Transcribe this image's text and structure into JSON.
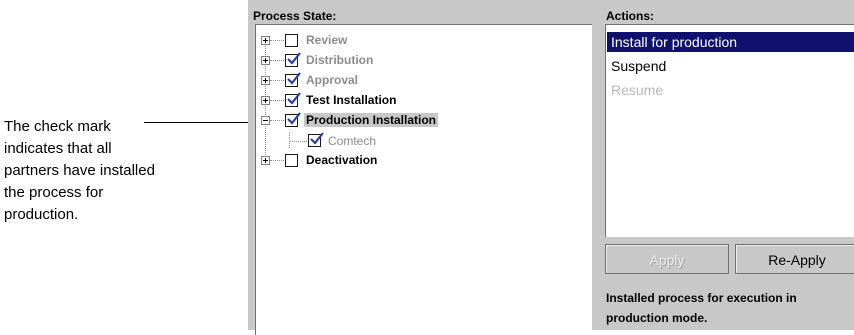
{
  "callout": {
    "lines": [
      "The check mark",
      "indicates that all",
      "partners have installed",
      "the process for",
      "production."
    ]
  },
  "process_state": {
    "heading": "Process State:",
    "items": [
      {
        "label": "Review",
        "checked": false,
        "style": "grey",
        "expander": "plus"
      },
      {
        "label": "Distribution",
        "checked": true,
        "style": "grey",
        "expander": "plus"
      },
      {
        "label": "Approval",
        "checked": true,
        "style": "grey",
        "expander": "plus"
      },
      {
        "label": "Test Installation",
        "checked": true,
        "style": "black",
        "expander": "plus"
      },
      {
        "label": "Production Installation",
        "checked": true,
        "style": "black",
        "expander": "minus",
        "selected": true
      },
      {
        "label": "Comtech",
        "checked": true,
        "style": "child",
        "expander": "none"
      },
      {
        "label": "Deactivation",
        "checked": false,
        "style": "black",
        "expander": "plus"
      }
    ]
  },
  "actions": {
    "heading": "Actions:",
    "items": [
      {
        "label": "Install for production",
        "state": "selected"
      },
      {
        "label": "Suspend",
        "state": "enabled"
      },
      {
        "label": "Resume",
        "state": "disabled"
      }
    ]
  },
  "buttons": {
    "apply": "Apply",
    "reapply": "Re-Apply"
  },
  "status": {
    "line1": "Installed process for execution in",
    "line2": "production mode."
  },
  "colors": {
    "panel": "#c8c8c8",
    "selection": "#10106e",
    "check": "#2a3ea0",
    "disabled_text": "#8c8c8c"
  }
}
